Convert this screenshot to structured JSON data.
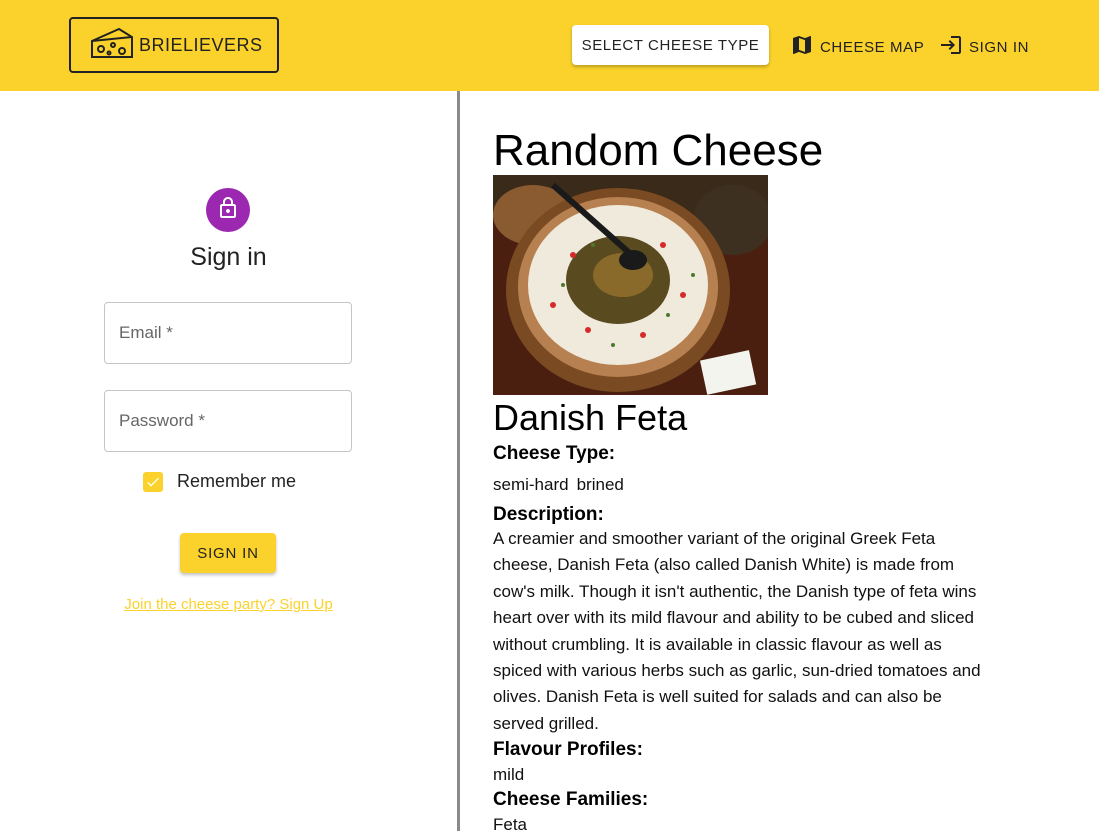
{
  "header": {
    "logo_text": "BRIELIEVERS",
    "select_label": "SELECT CHEESE TYPE",
    "map_label": "CHEESE MAP",
    "signin_label": "SIGN IN",
    "accent_color": "#fad22b"
  },
  "signin": {
    "title": "Sign in",
    "email_placeholder": "Email *",
    "password_placeholder": "Password *",
    "remember_label": "Remember me",
    "remember_checked": true,
    "button_label": "SIGN IN",
    "signup_link": "Join the cheese party? Sign Up",
    "lock_color": "#9c27b0"
  },
  "cheese": {
    "section_title": "Random Cheese",
    "name": "Danish Feta",
    "type_label": "Cheese Type:",
    "types": [
      "semi-hard",
      "brined"
    ],
    "description_label": "Description:",
    "description": "A creamier and smoother variant of the original Greek Feta cheese, Danish Feta (also called Danish White) is made from cow's milk. Though it isn't authentic, the Danish type of feta wins heart over with its mild flavour and ability to be cubed and sliced without crumbling. It is available in classic flavour as well as spiced with various herbs such as garlic, sun-dried tomatoes and olives. Danish Feta is well suited for salads and can also be served grilled.",
    "flavour_label": "Flavour Profiles:",
    "flavour": "mild",
    "families_label": "Cheese Families:",
    "family": "Feta"
  }
}
